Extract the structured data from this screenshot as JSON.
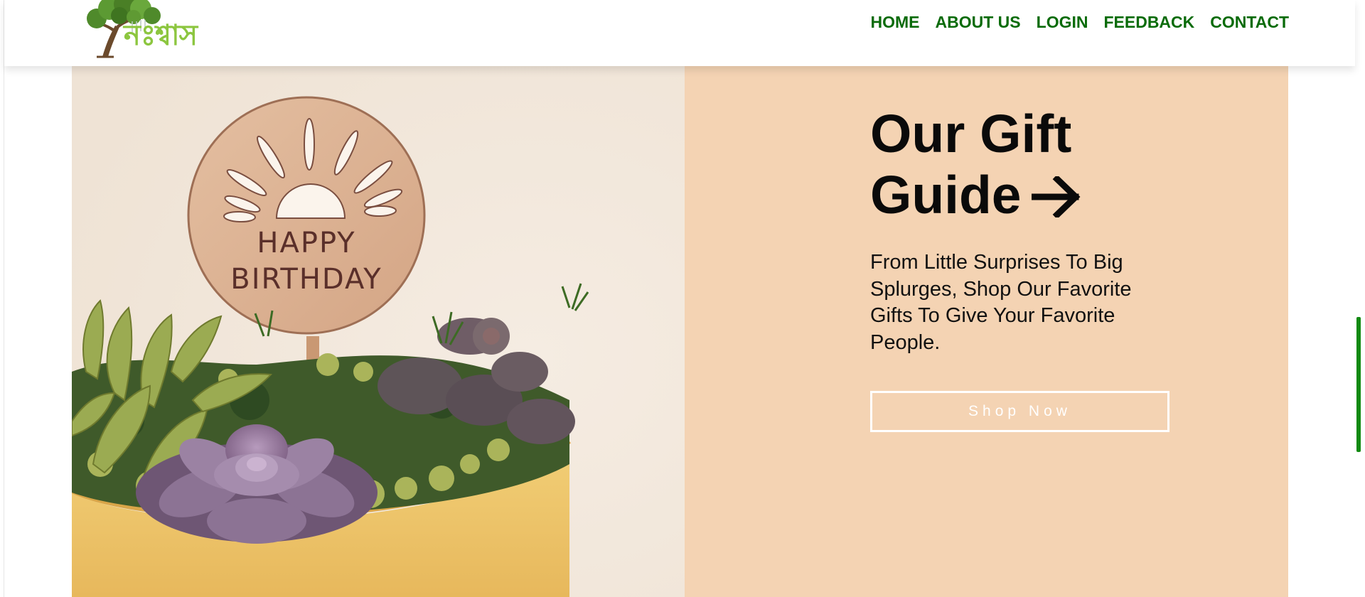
{
  "header": {
    "logo_text": "নঃশ্বাস",
    "nav": [
      {
        "label": "HOME"
      },
      {
        "label": "ABOUT US"
      },
      {
        "label": "LOGIN"
      },
      {
        "label": "FEEDBACK"
      },
      {
        "label": "CONTACT"
      }
    ]
  },
  "hero": {
    "image": {
      "sign_line1": "HAPPY",
      "sign_line2": "BIRTHDAY"
    },
    "title_line1": "Our Gift",
    "title_line2": "Guide",
    "arrow_icon": "arrow-right-icon",
    "description": "From Little Surprises To Big Splurges, Shop Our Favorite Gifts To Give Your Favorite People.",
    "button_label": "Shop Now"
  },
  "colors": {
    "nav_text": "#0a6b0a",
    "panel_background": "#f4d3b3",
    "button_border": "#ffffff",
    "scrollbar": "#128a12"
  }
}
